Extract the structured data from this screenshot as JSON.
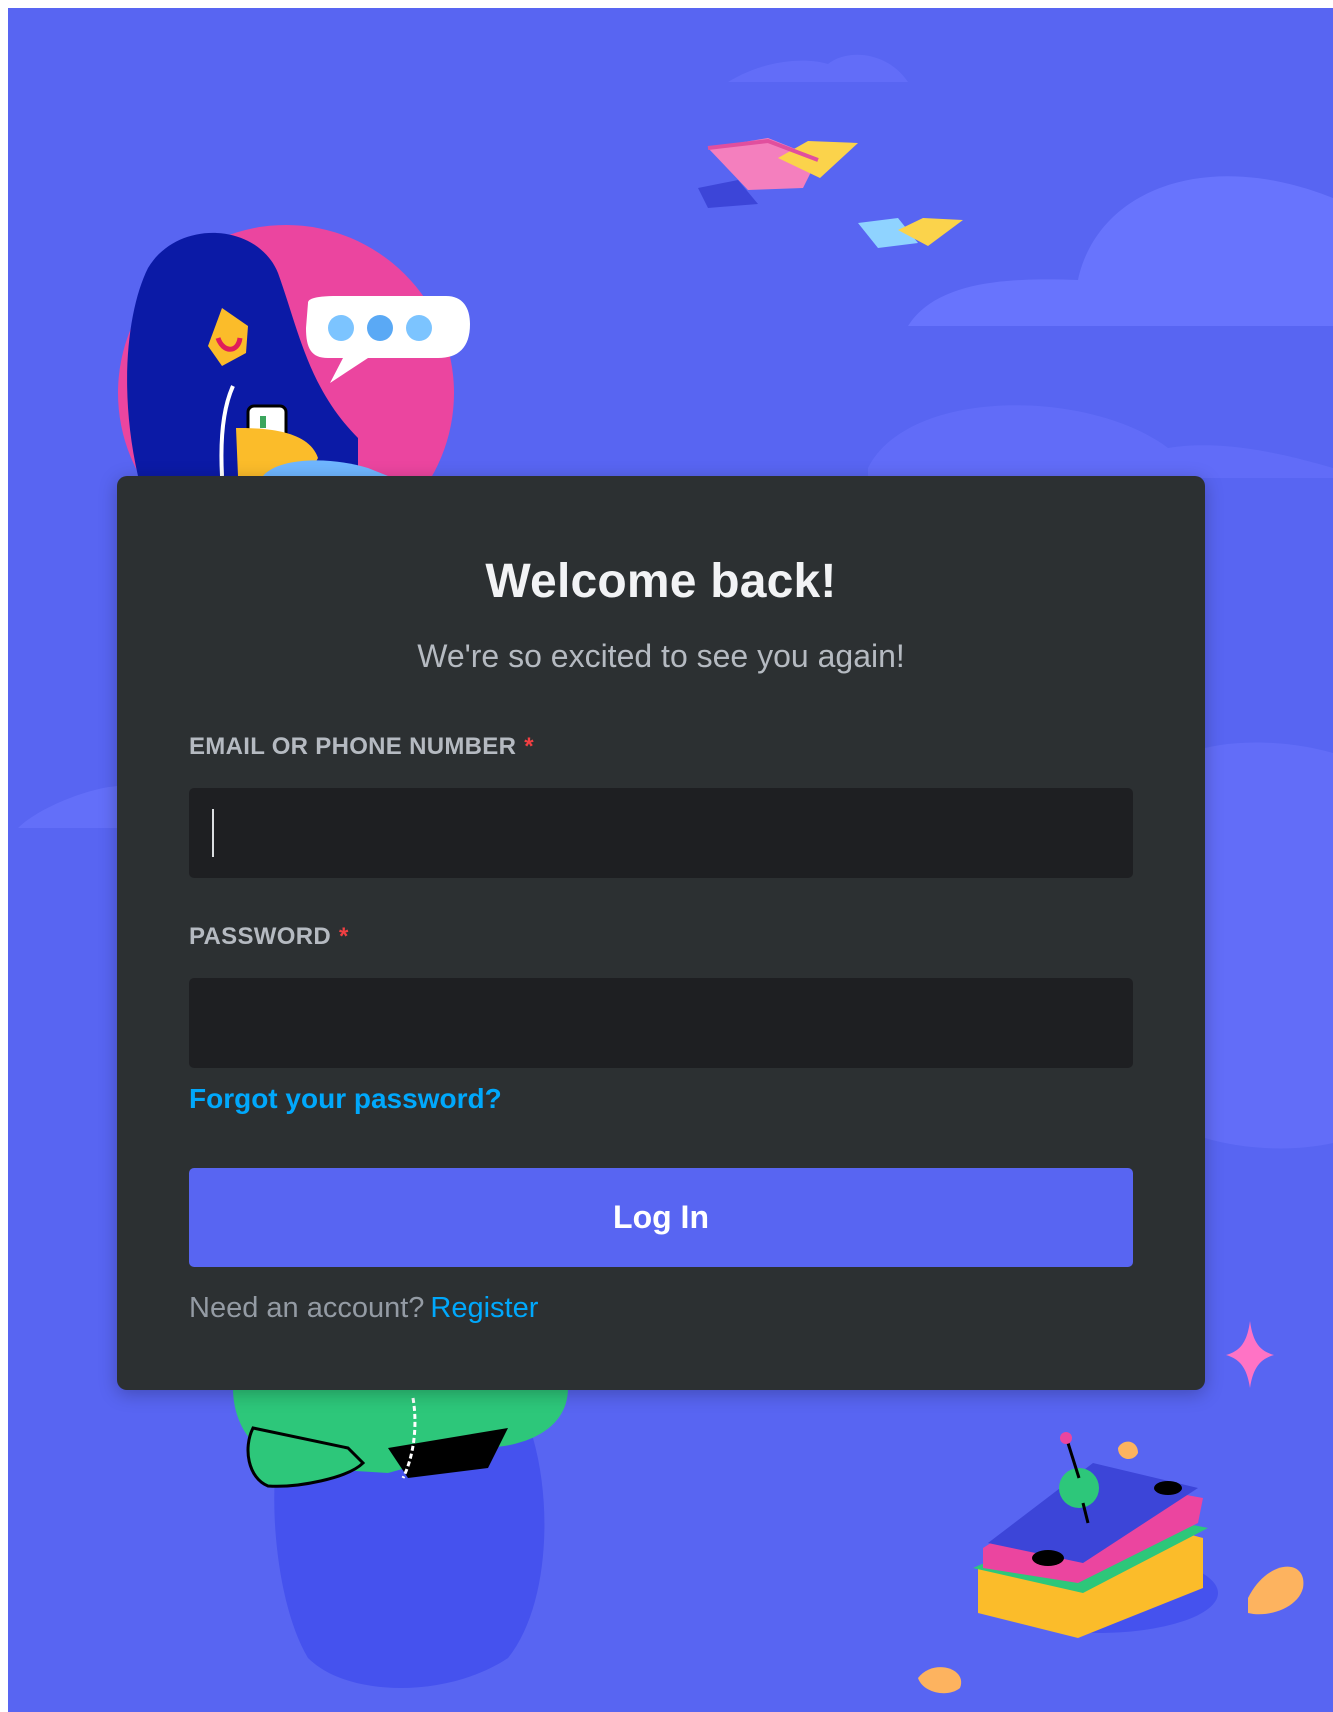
{
  "login": {
    "title": "Welcome back!",
    "subtitle": "We're so excited to see you again!",
    "email_label": "EMAIL OR PHONE NUMBER",
    "email_value": "",
    "password_label": "PASSWORD",
    "password_value": "",
    "required_marker": "*",
    "forgot_link": "Forgot your password?",
    "submit_label": "Log In",
    "register_prompt": "Need an account?",
    "register_link": "Register"
  },
  "colors": {
    "background": "#5865f2",
    "card": "#2c3032",
    "input": "#1e1f22",
    "button": "#5865f2",
    "link": "#00a8fc",
    "required": "#f23f42",
    "heading": "#f2f3f5",
    "muted": "#b5bac1"
  },
  "illustrations": [
    "chat-character-illustration",
    "speech-bubble-icon",
    "flying-book-icon",
    "cloud-shape",
    "sparkle-icon",
    "sandwich-illustration",
    "green-character-illustration"
  ]
}
